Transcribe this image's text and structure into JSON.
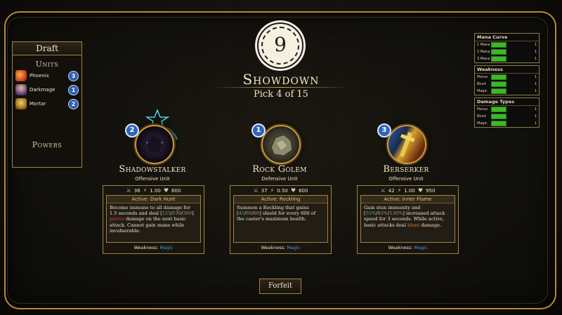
{
  "draft": {
    "title": "Draft",
    "units_heading": "Units",
    "powers_heading": "Powers",
    "units": [
      {
        "name": "Phoenix",
        "count": "3",
        "color": "#d8552a"
      },
      {
        "name": "Darkmage",
        "count": "1",
        "color": "#7a5bb8"
      },
      {
        "name": "Mortar",
        "count": "2",
        "color": "#c8a040"
      }
    ]
  },
  "header": {
    "counter": "9",
    "title": "Showdown",
    "subtitle": "Pick 4 of 15"
  },
  "stats_panel": {
    "mana_curve": {
      "title": "Mana Curve",
      "rows": [
        {
          "label": "1 Mana",
          "value": "1",
          "fill": 0.45
        },
        {
          "label": "2 Mana",
          "value": "1",
          "fill": 0.45
        },
        {
          "label": "3 Mana",
          "value": "1",
          "fill": 0.45
        }
      ]
    },
    "weakness": {
      "title": "Weakness",
      "rows": [
        {
          "label": "Pierce",
          "value": "1",
          "fill": 0.45
        },
        {
          "label": "Blunt",
          "value": "1",
          "fill": 0.45
        },
        {
          "label": "Magic",
          "value": "1",
          "fill": 0.45
        }
      ]
    },
    "damage_types": {
      "title": "Damage Types",
      "rows": [
        {
          "label": "Pierce",
          "value": "1",
          "fill": 0.45
        },
        {
          "label": "Blunt",
          "value": "1",
          "fill": 0.45
        },
        {
          "label": "Magic",
          "value": "1",
          "fill": 0.45
        }
      ]
    }
  },
  "cards": [
    {
      "level": "2",
      "name": "Shadowstalker",
      "role": "Offensive Unit",
      "attack": "36",
      "speed": "1.00",
      "health": "600",
      "ability_title": "Active: Dark Hunt",
      "ability_text_1": "Become immune to all damage for 1.5 seconds and deal [",
      "ability_v1": "125",
      "ability_sep1": "/",
      "ability_v2": "190",
      "ability_sep2": "/",
      "ability_v3": "300",
      "ability_text_2": "] ",
      "ability_kw": "pierce",
      "ability_text_3": " damage on the next basic attack. Cannot gain mana while invulnerable.",
      "weakness_label": "Weakness:",
      "weakness_value": "Magic"
    },
    {
      "level": "1",
      "name": "Rock Golem",
      "role": "Defensive Unit",
      "attack": "37",
      "speed": "0.50",
      "health": "800",
      "ability_title": "Active: Rockling",
      "ability_text_1": "Summon a Rockling that gains [",
      "ability_v1": "45",
      "ability_sep1": "/",
      "ability_v2": "60",
      "ability_sep2": "/",
      "ability_v3": "80",
      "ability_text_2": "] shield for every 600 of the caster's maximum health.",
      "ability_kw": "",
      "ability_text_3": "",
      "weakness_label": "Weakness:",
      "weakness_value": "Magic"
    },
    {
      "level": "3",
      "name": "Berserker",
      "role": "Offensive Unit",
      "attack": "42",
      "speed": "1.00",
      "health": "950",
      "ability_title": "Active: Inner Flame",
      "ability_text_1": "Gain stun immunity and [",
      "ability_v1": "55%",
      "ability_sep1": "/",
      "ability_v2": "83%",
      "ability_sep2": "/",
      "ability_v3": "130%",
      "ability_text_2": "] increased attack speed for 3 seconds. While active, basic attacks deal ",
      "ability_kw": "blunt",
      "ability_text_3": " damage.",
      "weakness_label": "Weakness:",
      "weakness_value": "Magic"
    }
  ],
  "forfeit_label": "Forfeit",
  "colors": {
    "gold": "#b38a3a",
    "accent_blue": "#2f64bc",
    "bar_green": "#3fb72a",
    "keyword_red": "#d8433a",
    "keyword_orange": "#e07a2c"
  }
}
